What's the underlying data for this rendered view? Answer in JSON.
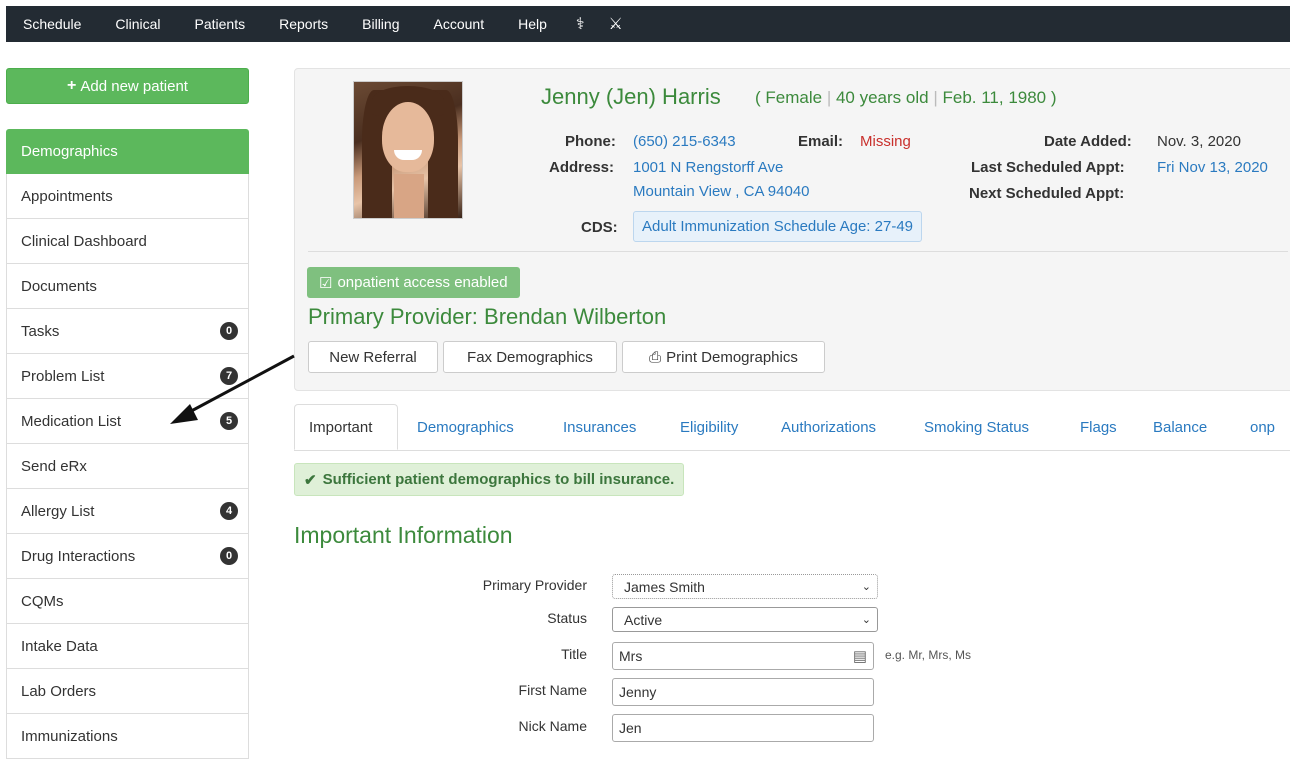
{
  "topnav": {
    "items": [
      "Schedule",
      "Clinical",
      "Patients",
      "Reports",
      "Billing",
      "Account",
      "Help"
    ]
  },
  "sidebar": {
    "add_button": "Add new patient",
    "items": [
      {
        "label": "Demographics",
        "badge": ""
      },
      {
        "label": "Appointments",
        "badge": ""
      },
      {
        "label": "Clinical Dashboard",
        "badge": ""
      },
      {
        "label": "Documents",
        "badge": ""
      },
      {
        "label": "Tasks",
        "badge": "0"
      },
      {
        "label": "Problem List",
        "badge": "7"
      },
      {
        "label": "Medication List",
        "badge": "5"
      },
      {
        "label": "Send eRx",
        "badge": ""
      },
      {
        "label": "Allergy List",
        "badge": "4"
      },
      {
        "label": "Drug Interactions",
        "badge": "0"
      },
      {
        "label": "CQMs",
        "badge": ""
      },
      {
        "label": "Intake Data",
        "badge": ""
      },
      {
        "label": "Lab Orders",
        "badge": ""
      },
      {
        "label": "Immunizations",
        "badge": ""
      }
    ]
  },
  "patient": {
    "name": "Jenny (Jen) Harris",
    "gender": "Female",
    "age": "40 years old",
    "dob": "Feb. 11, 1980",
    "phone_label": "Phone:",
    "phone": "(650) 215-6343",
    "email_label": "Email:",
    "email": "Missing",
    "address_label": "Address:",
    "address_line1": "1001 N Rengstorff Ave",
    "address_line2": "Mountain View , CA 94040",
    "cds_label": "CDS:",
    "cds": "Adult Immunization Schedule Age: 27-49",
    "date_added_label": "Date Added:",
    "date_added": "Nov. 3, 2020",
    "last_appt_label": "Last Scheduled Appt:",
    "last_appt": "Fri Nov 13, 2020",
    "next_appt_label": "Next Scheduled Appt:",
    "access": "onpatient access enabled",
    "primary_provider": "Primary Provider: Brendan Wilberton"
  },
  "actions": {
    "new_referral": "New Referral",
    "fax": "Fax Demographics",
    "print": "Print Demographics"
  },
  "tabs": [
    "Important",
    "Demographics",
    "Insurances",
    "Eligibility",
    "Authorizations",
    "Smoking Status",
    "Flags",
    "Balance",
    "onp"
  ],
  "alert": "Sufficient patient demographics to bill insurance.",
  "section_title": "Important Information",
  "form": {
    "primary_provider_label": "Primary Provider",
    "primary_provider_value": "James Smith",
    "status_label": "Status",
    "status_value": "Active",
    "title_label": "Title",
    "title_value": "Mrs",
    "title_hint": "e.g. Mr, Mrs, Ms",
    "first_name_label": "First Name",
    "first_name_value": "Jenny",
    "nick_name_label": "Nick Name",
    "nick_name_value": "Jen"
  },
  "colors": {
    "nav_bg": "#232b33",
    "accent_green": "#5cb85c",
    "link_blue": "#2a7ac0"
  }
}
